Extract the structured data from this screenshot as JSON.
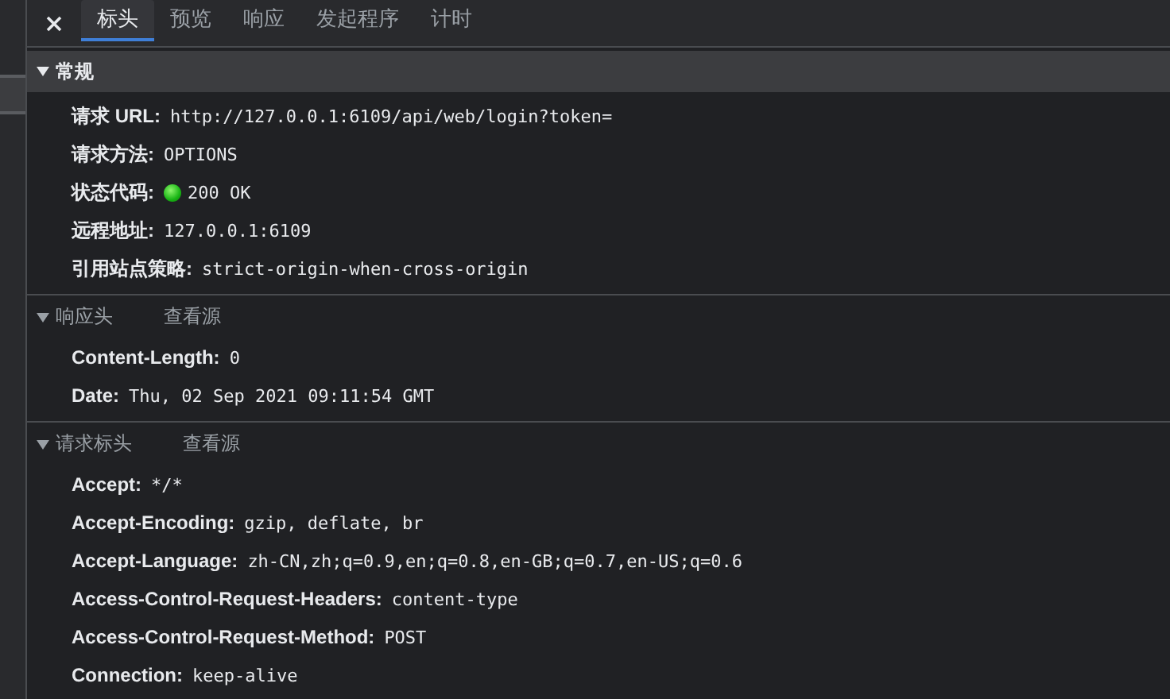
{
  "tabs": [
    {
      "label": "标头",
      "selected": true
    },
    {
      "label": "预览",
      "selected": false
    },
    {
      "label": "响应",
      "selected": false
    },
    {
      "label": "发起程序",
      "selected": false
    },
    {
      "label": "计时",
      "selected": false
    }
  ],
  "sections": [
    {
      "title": "常规",
      "expanded": true,
      "focused": true,
      "rows": [
        {
          "key": "请求 URL:",
          "value": "http://127.0.0.1:6109/api/web/login?token="
        },
        {
          "key": "请求方法:",
          "value": "OPTIONS"
        },
        {
          "key": "状态代码:",
          "value": "200 OK",
          "kind": "status"
        },
        {
          "key": "远程地址:",
          "value": "127.0.0.1:6109"
        },
        {
          "key": "引用站点策略:",
          "value": "strict-origin-when-cross-origin"
        }
      ]
    },
    {
      "title": "响应头",
      "link": "查看源",
      "expanded": true,
      "focused": false,
      "rows": [
        {
          "key": "Content-Length:",
          "value": "0"
        },
        {
          "key": "Date:",
          "value": "Thu, 02 Sep 2021 09:11:54 GMT"
        }
      ]
    },
    {
      "title": "请求标头",
      "link": "查看源",
      "expanded": true,
      "focused": false,
      "rows": [
        {
          "key": "Accept:",
          "value": "*/*"
        },
        {
          "key": "Accept-Encoding:",
          "value": "gzip, deflate, br"
        },
        {
          "key": "Accept-Language:",
          "value": "zh-CN,zh;q=0.9,en;q=0.8,en-GB;q=0.7,en-US;q=0.6"
        },
        {
          "key": "Access-Control-Request-Headers:",
          "value": "content-type"
        },
        {
          "key": "Access-Control-Request-Method:",
          "value": "POST"
        },
        {
          "key": "Connection:",
          "value": "keep-alive"
        }
      ]
    }
  ]
}
